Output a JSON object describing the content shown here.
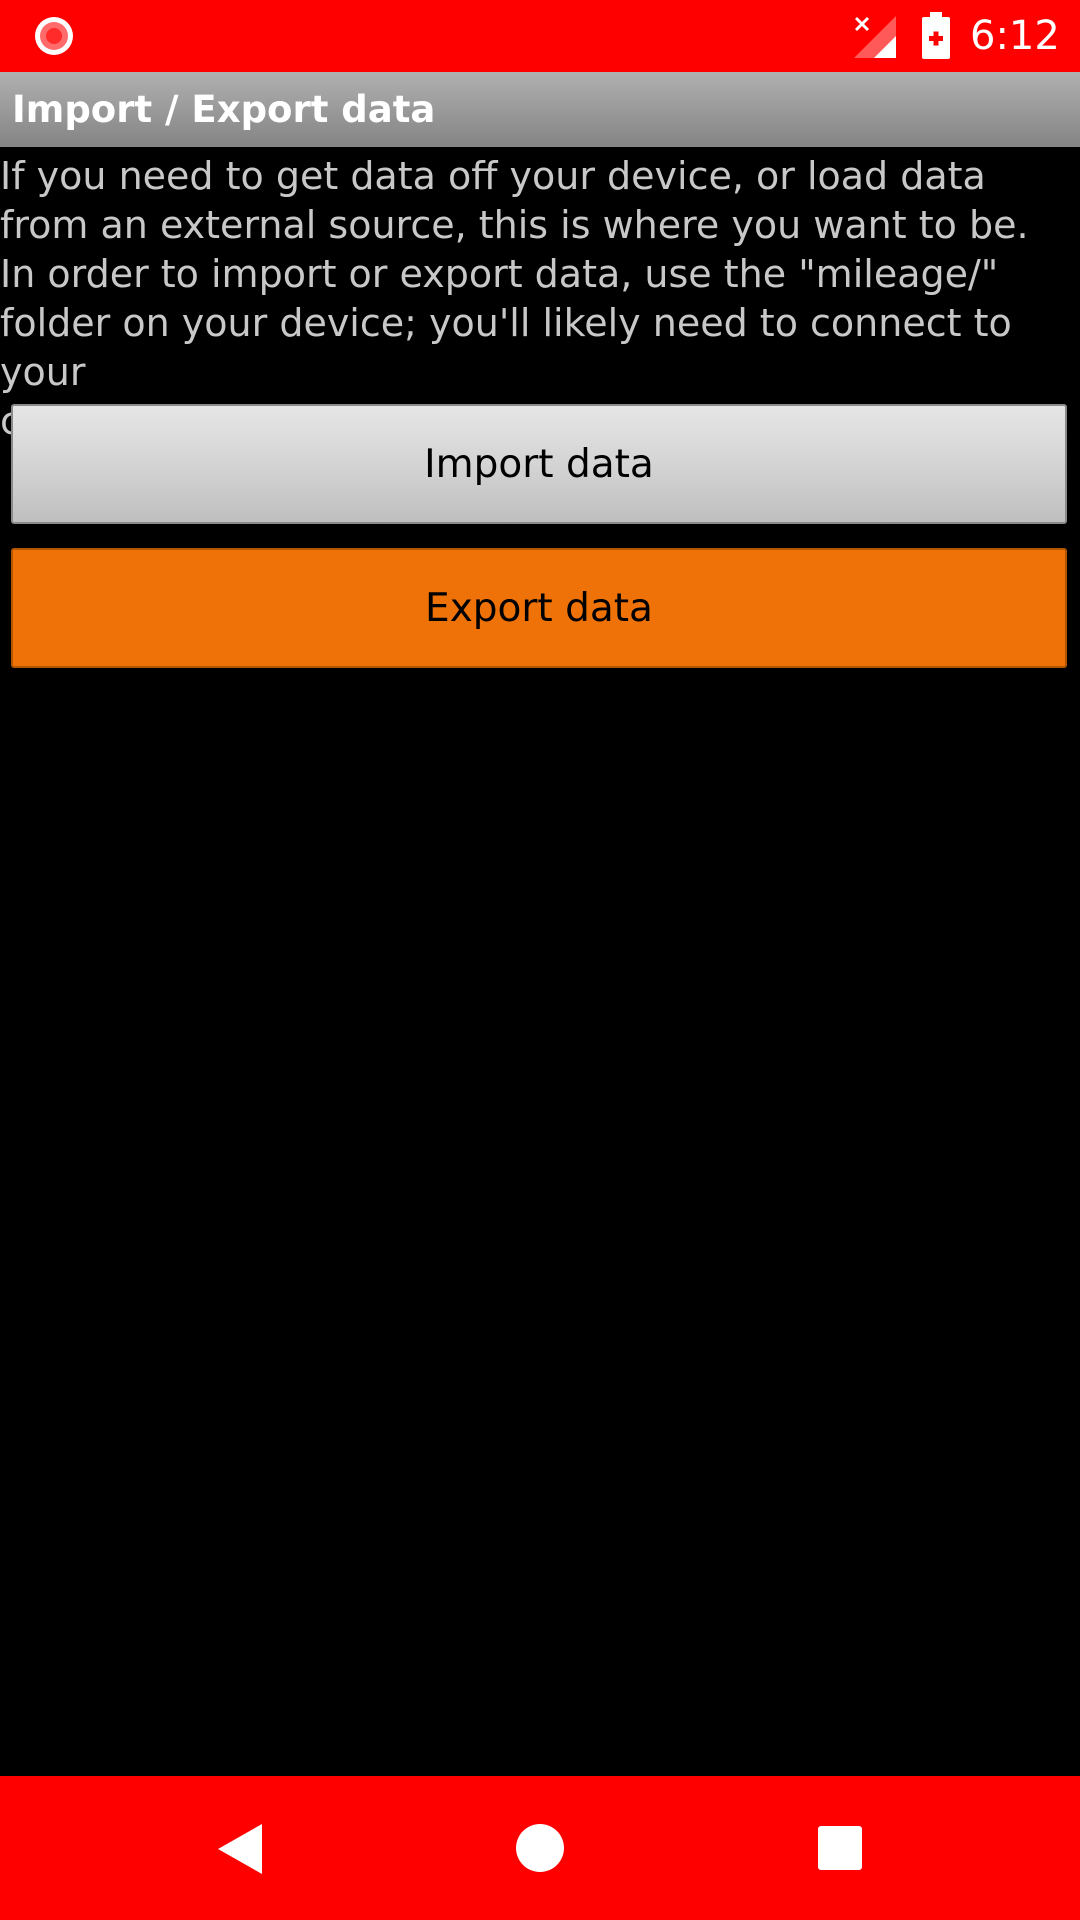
{
  "status_bar": {
    "time": "6:12",
    "color": "#ff0000",
    "icons": [
      "screen-record-icon",
      "no-signal-icon",
      "battery-charging-icon"
    ]
  },
  "app_bar": {
    "title": "Import / Export data"
  },
  "content": {
    "description": "If you need to get data off your device, or load data\nfrom an external source, this is where you want to be.\nIn order to import or export data, use the \"mileage/\"\nfolder on your device; you'll likely need to connect to your\ncomputer via USB for this."
  },
  "buttons": {
    "import_label": "Import data",
    "export_label": "Export data",
    "export_color": "#ee7208"
  },
  "nav_bar": {
    "color": "#ff0000",
    "icons": [
      "back-icon",
      "home-icon",
      "recents-icon"
    ]
  }
}
